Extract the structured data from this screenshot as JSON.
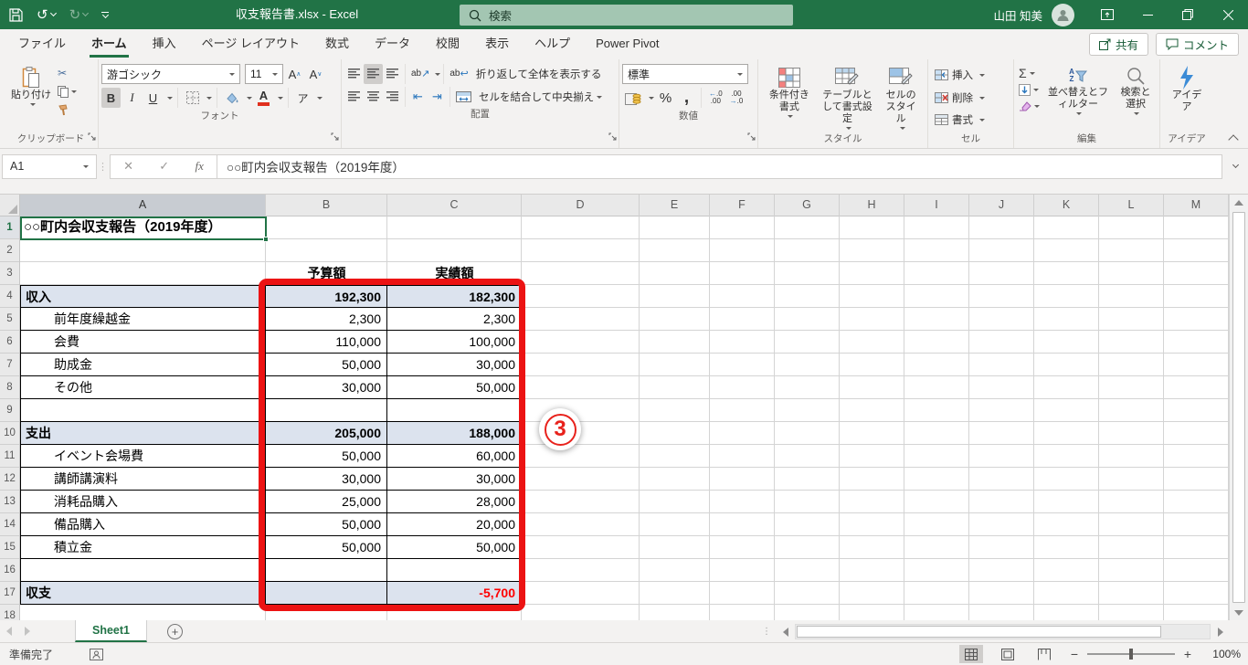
{
  "titlebar": {
    "title": "収支報告書.xlsx - Excel",
    "search_placeholder": "検索",
    "user_name": "山田 知美"
  },
  "ribbon": {
    "tabs": [
      {
        "label": "ファイル",
        "active": false
      },
      {
        "label": "ホーム",
        "active": true
      },
      {
        "label": "挿入",
        "active": false
      },
      {
        "label": "ページ レイアウト",
        "active": false
      },
      {
        "label": "数式",
        "active": false
      },
      {
        "label": "データ",
        "active": false
      },
      {
        "label": "校閲",
        "active": false
      },
      {
        "label": "表示",
        "active": false
      },
      {
        "label": "ヘルプ",
        "active": false
      },
      {
        "label": "Power Pivot",
        "active": false
      }
    ],
    "share": "共有",
    "comment": "コメント",
    "clipboard": {
      "label": "クリップボード",
      "paste": "貼り付け"
    },
    "font": {
      "label": "フォント",
      "name": "游ゴシック",
      "size": "11",
      "bold": "B",
      "italic": "I",
      "underline": "U",
      "phonetic": "ア"
    },
    "align": {
      "label": "配置",
      "wrap": "折り返して全体を表示する",
      "merge": "セルを結合して中央揃え"
    },
    "number": {
      "label": "数値",
      "format": "標準",
      "percent": "%",
      "comma": ","
    },
    "styles": {
      "label": "スタイル",
      "conditional": "条件付き書式",
      "table": "テーブルとして書式設定",
      "cell": "セルのスタイル"
    },
    "cells": {
      "label": "セル",
      "insert": "挿入",
      "delete": "削除",
      "format": "書式"
    },
    "editing": {
      "label": "編集",
      "sigma": "Σ",
      "sort": "並べ替えとフィルター",
      "find": "検索と選択"
    },
    "ideas": {
      "label": "アイデア",
      "button": "アイデア"
    }
  },
  "formula_bar": {
    "name_box": "A1",
    "fx": "fx",
    "formula": "○○町内会収支報告（2019年度）"
  },
  "sheet": {
    "title_cell": "○○町内会収支報告（2019年度）",
    "column_headers": [
      "A",
      "B",
      "C",
      "D",
      "E",
      "F",
      "G",
      "H",
      "I",
      "J",
      "K",
      "L",
      "M"
    ],
    "row_count": 18,
    "selected_cell": "A1",
    "table_rows": [
      {
        "row": 3,
        "label": "",
        "budget": "予算額",
        "actual": "実績額",
        "kind": "head"
      },
      {
        "row": 4,
        "label": "収入",
        "budget": "192,300",
        "actual": "182,300",
        "kind": "section"
      },
      {
        "row": 5,
        "label": "前年度繰越金",
        "budget": "2,300",
        "actual": "2,300",
        "kind": "detail"
      },
      {
        "row": 6,
        "label": "会費",
        "budget": "110,000",
        "actual": "100,000",
        "kind": "detail"
      },
      {
        "row": 7,
        "label": "助成金",
        "budget": "50,000",
        "actual": "30,000",
        "kind": "detail"
      },
      {
        "row": 8,
        "label": "その他",
        "budget": "30,000",
        "actual": "50,000",
        "kind": "detail"
      },
      {
        "row": 9,
        "label": "",
        "budget": "",
        "actual": "",
        "kind": "blank"
      },
      {
        "row": 10,
        "label": "支出",
        "budget": "205,000",
        "actual": "188,000",
        "kind": "section"
      },
      {
        "row": 11,
        "label": "イベント会場費",
        "budget": "50,000",
        "actual": "60,000",
        "kind": "detail"
      },
      {
        "row": 12,
        "label": "講師講演料",
        "budget": "30,000",
        "actual": "30,000",
        "kind": "detail"
      },
      {
        "row": 13,
        "label": "消耗品購入",
        "budget": "25,000",
        "actual": "28,000",
        "kind": "detail"
      },
      {
        "row": 14,
        "label": "備品購入",
        "budget": "50,000",
        "actual": "20,000",
        "kind": "detail"
      },
      {
        "row": 15,
        "label": "積立金",
        "budget": "50,000",
        "actual": "50,000",
        "kind": "detail"
      },
      {
        "row": 16,
        "label": "",
        "budget": "",
        "actual": "",
        "kind": "blank"
      },
      {
        "row": 17,
        "label": "収支",
        "budget": "",
        "actual": "-5,700",
        "kind": "section",
        "negative": true
      }
    ],
    "annotation_badge": "3"
  },
  "sheet_bar": {
    "active_tab": "Sheet1"
  },
  "status_bar": {
    "mode": "準備完了",
    "zoom_level": "100%"
  },
  "colors": {
    "excel_green": "#217346",
    "section_row_fill": "#dce3ee",
    "negative_number": "#ff0000",
    "annotation_red": "#ec1313",
    "search_box_green": "#a3c6b2"
  }
}
